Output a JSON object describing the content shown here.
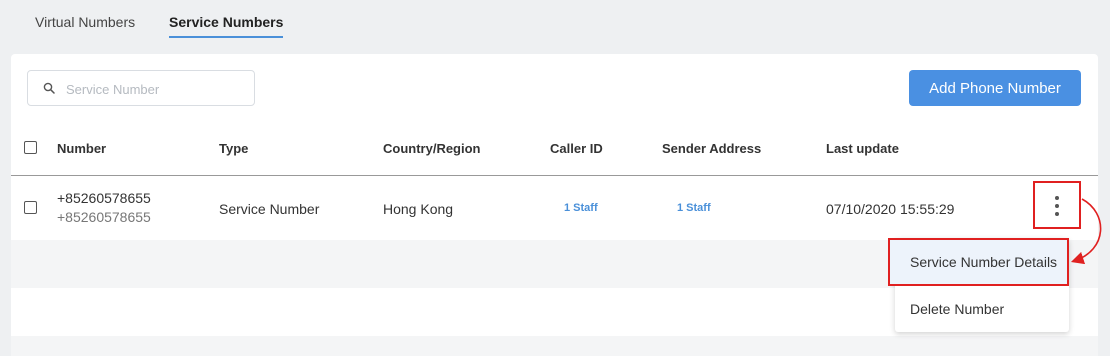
{
  "tabs": [
    {
      "label": "Virtual Numbers",
      "active": false
    },
    {
      "label": "Service Numbers",
      "active": true
    }
  ],
  "search": {
    "placeholder": "Service Number",
    "value": ""
  },
  "add_button": {
    "label": "Add Phone Number"
  },
  "table": {
    "columns": [
      "Number",
      "Type",
      "Country/Region",
      "Caller ID",
      "Sender Address",
      "Last update"
    ],
    "rows": [
      {
        "number": "+85260578655",
        "number_sub": "+85260578655",
        "type": "Service Number",
        "country": "Hong Kong",
        "caller_id": "1 Staff",
        "sender_address": "1 Staff",
        "last_update": "07/10/2020 15:55:29"
      }
    ]
  },
  "row_menu": {
    "items": [
      "Service Number Details",
      "Delete Number"
    ]
  },
  "colors": {
    "accent": "#4a90e2",
    "highlight": "#e02020",
    "background": "#eef0f2"
  },
  "icons": {
    "search": "search-icon",
    "more": "more-vertical-icon"
  }
}
